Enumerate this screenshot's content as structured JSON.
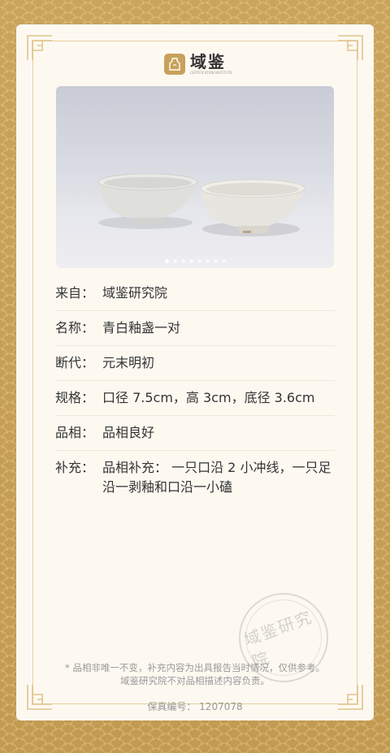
{
  "brand": {
    "name": "域鉴",
    "tagline": "CERTIFICATION INSTITUTE"
  },
  "gallery": {
    "image_alt": "two celadon glazed bowls",
    "dot_count": 8,
    "active_index": 0
  },
  "details": [
    {
      "label": "来自：",
      "value": "域鉴研究院"
    },
    {
      "label": "名称：",
      "value": "青白釉盏一对"
    },
    {
      "label": "断代：",
      "value": "元末明初"
    },
    {
      "label": "规格：",
      "value": "口径 7.5cm，高 3cm，底径 3.6cm"
    },
    {
      "label": "品相：",
      "value": "品相良好"
    },
    {
      "label": "补充：",
      "value": "品相补充： 一只口沿 2 小冲线，一只足沿一剥釉和口沿一小磕"
    }
  ],
  "note": "* 品相非唯一不变，补充内容为出具报告当时情况，仅供参考。域鉴研究院不对品相描述内容负责。",
  "serial": "保真编号： 1207078",
  "stamp_text": "域鉴研究院",
  "colors": {
    "gold": "#c9a35a",
    "card": "#fdf9f1",
    "frame": "#e7cf9c"
  }
}
